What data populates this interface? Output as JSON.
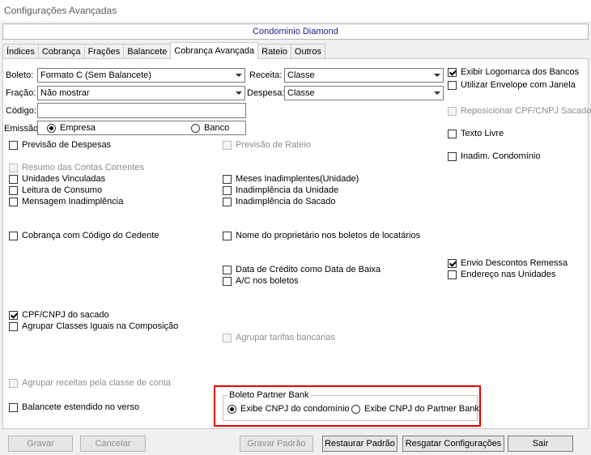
{
  "window": {
    "title": "Configurações Avançadas"
  },
  "condominio": "Condominio Diamond",
  "tabs": [
    "Índices",
    "Cobrança",
    "Frações",
    "Balancete",
    "Cobrança Avançada",
    "Rateio",
    "Outros"
  ],
  "form": {
    "boleto": {
      "label": "Boleto:",
      "value": "Formato C (Sem Balancete)"
    },
    "fracao": {
      "label": "Fração:",
      "value": "Não mostrar"
    },
    "codigo": {
      "label": "Código:",
      "value": ""
    },
    "emissao": {
      "label": "Emissão:",
      "options": [
        "Empresa",
        "Banco"
      ],
      "selected": "Empresa"
    },
    "receita": {
      "label": "Receita:",
      "value": "Classe"
    },
    "despesa": {
      "label": "Despesa:",
      "value": "Classe"
    }
  },
  "checkboxes": {
    "exibir_logomarca": {
      "label": "Exibir Logomarca dos Bancos",
      "checked": true,
      "enabled": true
    },
    "utilizar_envelope": {
      "label": "Utilizar Envelope com Janela",
      "checked": false,
      "enabled": true
    },
    "reposicionar_cpf": {
      "label": "Reposicionar CPF/CNPJ Sacado",
      "checked": false,
      "enabled": false
    },
    "texto_livre": {
      "label": "Texto Livre",
      "checked": false,
      "enabled": true
    },
    "inadim_condominio": {
      "label": "Inadim. Condomínio",
      "checked": false,
      "enabled": true
    },
    "previsao_despesas": {
      "label": "Previsão de Despesas",
      "checked": false,
      "enabled": true
    },
    "previsao_rateio": {
      "label": "Previsão de Rateio",
      "checked": false,
      "enabled": false
    },
    "resumo_contas": {
      "label": "Resumo das Contas Correntes",
      "checked": false,
      "enabled": false
    },
    "unidades_vinculadas": {
      "label": "Unidades Vinculadas",
      "checked": false,
      "enabled": true
    },
    "leitura_consumo": {
      "label": "Leitura de Consumo",
      "checked": false,
      "enabled": true
    },
    "mensagem_inadimplencia": {
      "label": "Mensagem Inadimplência",
      "checked": false,
      "enabled": true
    },
    "meses_inadimplentes": {
      "label": "Meses Inadimplentes(Unidade)",
      "checked": false,
      "enabled": true
    },
    "inadimplencia_unidade": {
      "label": "Inadimplência da Unidade",
      "checked": false,
      "enabled": true
    },
    "inadimplencia_sacado": {
      "label": "Inadimplência do Sacado",
      "checked": false,
      "enabled": true
    },
    "cobranca_codigo_cedente": {
      "label": "Cobrança com Código do Cedente",
      "checked": false,
      "enabled": true
    },
    "nome_proprietario": {
      "label": "Nome do proprietário nos boletos de locatários",
      "checked": false,
      "enabled": true
    },
    "data_credito": {
      "label": "Data de Crédito como Data de Baixa",
      "checked": false,
      "enabled": true
    },
    "ac_boletos": {
      "label": "A/C nos boletos",
      "checked": false,
      "enabled": true
    },
    "envio_descontos": {
      "label": "Envio Descontos Remessa",
      "checked": true,
      "enabled": true
    },
    "endereco_unidades": {
      "label": "Endereço nas Unidades",
      "checked": false,
      "enabled": true
    },
    "cpf_cnpj_sacado": {
      "label": "CPF/CNPJ do sacado",
      "checked": true,
      "enabled": true
    },
    "agrupar_classes": {
      "label": "Agrupar Classes Iguais na Composição",
      "checked": false,
      "enabled": true
    },
    "agrupar_tarifas": {
      "label": "Agrupar tarifas bancárias",
      "checked": false,
      "enabled": false
    },
    "agrupar_receitas": {
      "label": "Agrupar receitas pela classe de conta",
      "checked": false,
      "enabled": false
    },
    "balancete_verso": {
      "label": "Balancete estendido no verso",
      "checked": false,
      "enabled": true
    }
  },
  "partner_bank": {
    "title": "Boleto Partner Bank",
    "options": [
      "Exibe CNPJ do condomínio",
      "Exibe CNPJ do Partner Bank"
    ],
    "selected": "Exibe CNPJ do condomínio"
  },
  "buttons": {
    "gravar": "Gravar",
    "cancelar": "Cancelar",
    "gravar_padrao": "Gravar Padrão",
    "restaurar_padrao": "Restaurar Padrão",
    "resgatar_configuracoes": "Resgatar Configurações",
    "sair": "Sair"
  }
}
